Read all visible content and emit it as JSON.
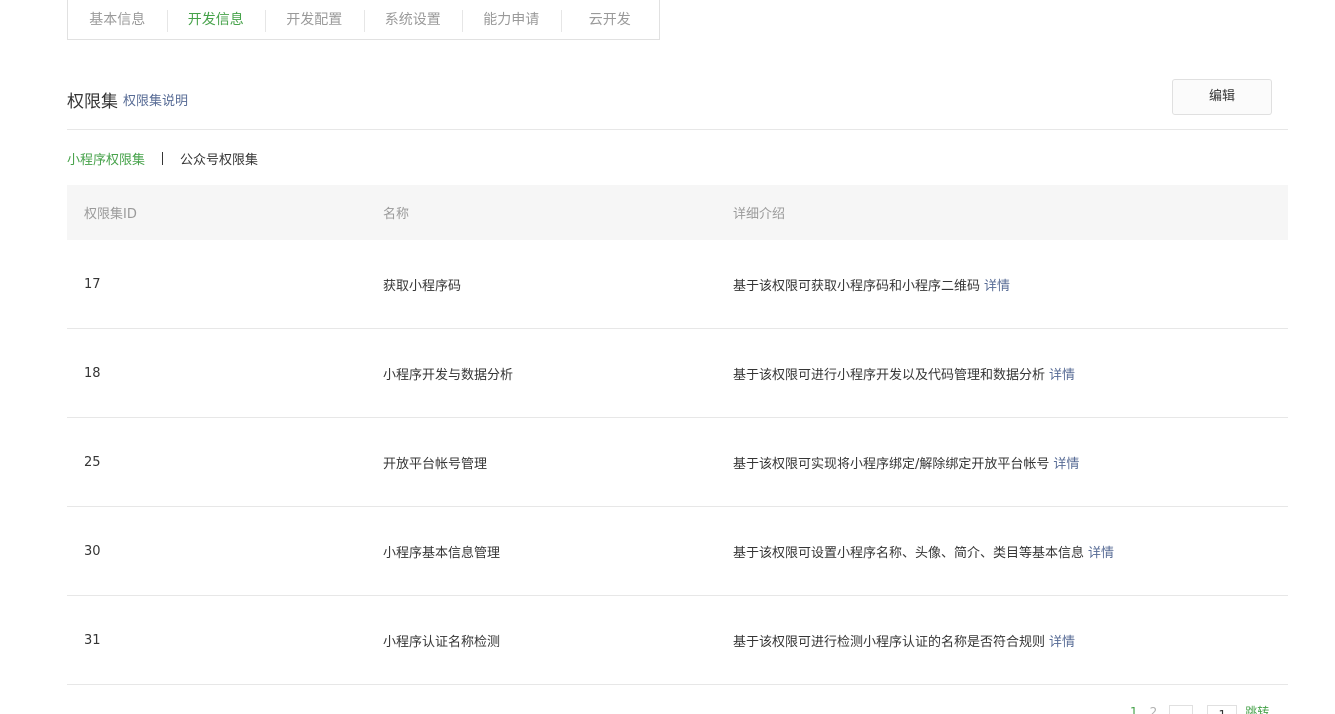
{
  "tabs": [
    {
      "label": "基本信息",
      "active": false
    },
    {
      "label": "开发信息",
      "active": true
    },
    {
      "label": "开发配置",
      "active": false
    },
    {
      "label": "系统设置",
      "active": false
    },
    {
      "label": "能力申请",
      "active": false
    },
    {
      "label": "云开发",
      "active": false
    }
  ],
  "section": {
    "title": "权限集",
    "help_link": "权限集说明",
    "edit_label": "编辑"
  },
  "sub_tabs": [
    {
      "label": "小程序权限集",
      "active": true
    },
    {
      "label": "公众号权限集",
      "active": false
    }
  ],
  "table": {
    "headers": [
      "权限集ID",
      "名称",
      "详细介绍"
    ],
    "detail_label": "详情",
    "rows": [
      {
        "id": "17",
        "name": "获取小程序码",
        "desc": "基于该权限可获取小程序码和小程序二维码"
      },
      {
        "id": "18",
        "name": "小程序开发与数据分析",
        "desc": "基于该权限可进行小程序开发以及代码管理和数据分析"
      },
      {
        "id": "25",
        "name": "开放平台帐号管理",
        "desc": "基于该权限可实现将小程序绑定/解除绑定开放平台帐号"
      },
      {
        "id": "30",
        "name": "小程序基本信息管理",
        "desc": "基于该权限可设置小程序名称、头像、简介、类目等基本信息"
      },
      {
        "id": "31",
        "name": "小程序认证名称检测",
        "desc": "基于该权限可进行检测小程序认证的名称是否符合规则"
      }
    ]
  },
  "pagination": {
    "current": "1",
    "next": "2",
    "input_value": "1",
    "jump_label": "跳转"
  },
  "colors": {
    "accent_green": "#46a24a",
    "link_blue": "#576b95"
  }
}
